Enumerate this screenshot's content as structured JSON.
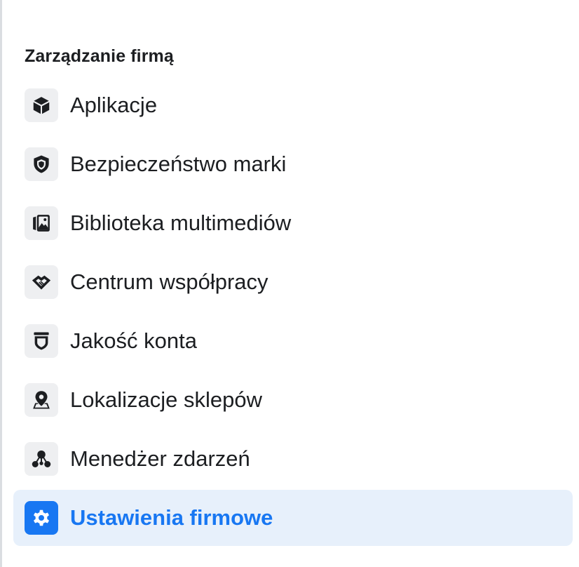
{
  "section": {
    "title": "Zarządzanie firmą"
  },
  "menu": {
    "items": [
      {
        "label": "Aplikacje",
        "icon": "box-icon",
        "active": false
      },
      {
        "label": "Bezpieczeństwo marki",
        "icon": "shield-icon",
        "active": false
      },
      {
        "label": "Biblioteka multimediów",
        "icon": "media-library-icon",
        "active": false
      },
      {
        "label": "Centrum współpracy",
        "icon": "handshake-icon",
        "active": false
      },
      {
        "label": "Jakość konta",
        "icon": "account-quality-icon",
        "active": false
      },
      {
        "label": "Lokalizacje sklepów",
        "icon": "map-pin-icon",
        "active": false
      },
      {
        "label": "Menedżer zdarzeń",
        "icon": "events-manager-icon",
        "active": false
      },
      {
        "label": "Ustawienia firmowe",
        "icon": "gear-icon",
        "active": true
      }
    ]
  },
  "colors": {
    "accent": "#1877f2",
    "active_background": "#e7f0fb",
    "text": "#1c1e21",
    "icon_tile": "#eeeff1"
  }
}
